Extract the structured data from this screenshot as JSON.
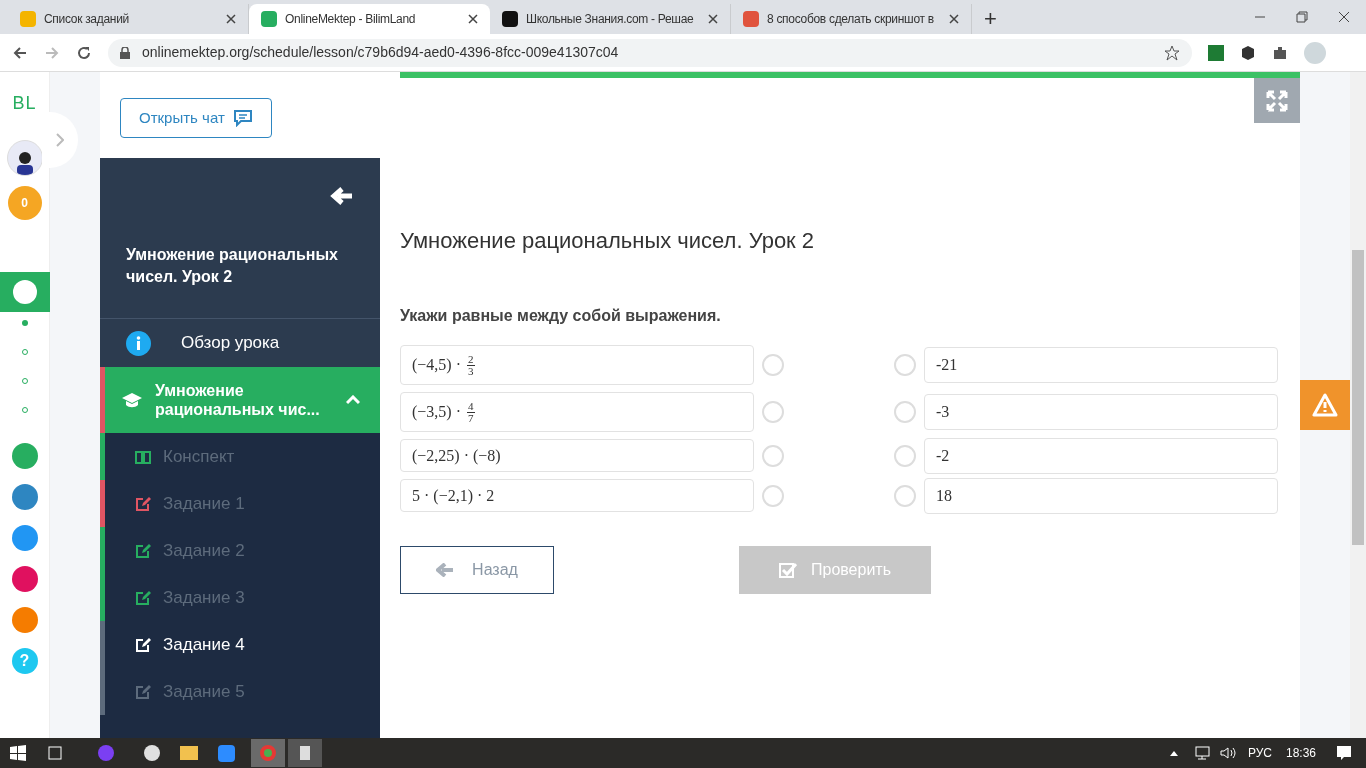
{
  "browser": {
    "tabs": [
      {
        "title": "Список заданий",
        "color": "#f4b400",
        "selected": false
      },
      {
        "title": "OnlineMektep - BilimLand",
        "color": "#27ae60",
        "selected": true
      },
      {
        "title": "Школьные Знания.com - Решае",
        "color": "#111111",
        "selected": false
      },
      {
        "title": "8 способов сделать скриншот в",
        "color": "#e0533d",
        "selected": false
      }
    ],
    "new_tab": "+",
    "url": "onlinemektep.org/schedule/lesson/c79b6d94-aed0-4396-8fcc-009e41307c04"
  },
  "rail": {
    "logo": "BL",
    "coins": "0",
    "dots": [
      {
        "selected": true
      },
      {
        "selected": false
      },
      {
        "selected": false
      },
      {
        "selected": false
      }
    ],
    "apps": [
      {
        "color": "#27ae60"
      },
      {
        "color": "#2e86c1"
      },
      {
        "color": "#2196f3"
      },
      {
        "color": "#e0115f"
      },
      {
        "color": "#f57c00"
      }
    ],
    "help": "?"
  },
  "chat_button": "Открыть чат",
  "sidebar": {
    "title": "Умножение рациональных чисел. Урок 2",
    "overview": "Обзор урока",
    "section": {
      "title": "Умножение рациональных чис...",
      "expanded": true
    },
    "items": [
      {
        "label": "Конспект",
        "kind": "note",
        "color": "#27ae60",
        "selected": false
      },
      {
        "label": "Задание 1",
        "kind": "task",
        "color": "#e05563",
        "selected": false
      },
      {
        "label": "Задание 2",
        "kind": "task",
        "color": "#27ae60",
        "selected": false
      },
      {
        "label": "Задание 3",
        "kind": "task",
        "color": "#27ae60",
        "selected": false
      },
      {
        "label": "Задание 4",
        "kind": "task",
        "color": "#5d6b7c",
        "selected": true
      },
      {
        "label": "Задание 5",
        "kind": "task",
        "color": "#5d6b7c",
        "selected": false
      }
    ]
  },
  "progress": {
    "level": 1
  },
  "lesson": {
    "title": "Умножение рациональных чисел. Урок 2",
    "question": "Укажи равные между собой выражения.",
    "left": [
      {
        "text": "(−4,5) ·",
        "fraction": {
          "num": "2",
          "den": "3"
        },
        "selected": false
      },
      {
        "text": "(−3,5) ·",
        "fraction": {
          "num": "4",
          "den": "7"
        },
        "selected": false
      },
      {
        "text": "(−2,25) · (−8)",
        "selected": false
      },
      {
        "text": "5 · (−2,1) · 2",
        "selected": false
      }
    ],
    "right": [
      {
        "text": "-21",
        "selected": false
      },
      {
        "text": "-3",
        "selected": false
      },
      {
        "text": "-2",
        "selected": false
      },
      {
        "text": "18",
        "selected": false
      }
    ],
    "back": "Назад",
    "check": {
      "label": "Проверить",
      "disabled": true
    }
  },
  "taskbar": {
    "language": "РУС",
    "time": "18:36"
  }
}
